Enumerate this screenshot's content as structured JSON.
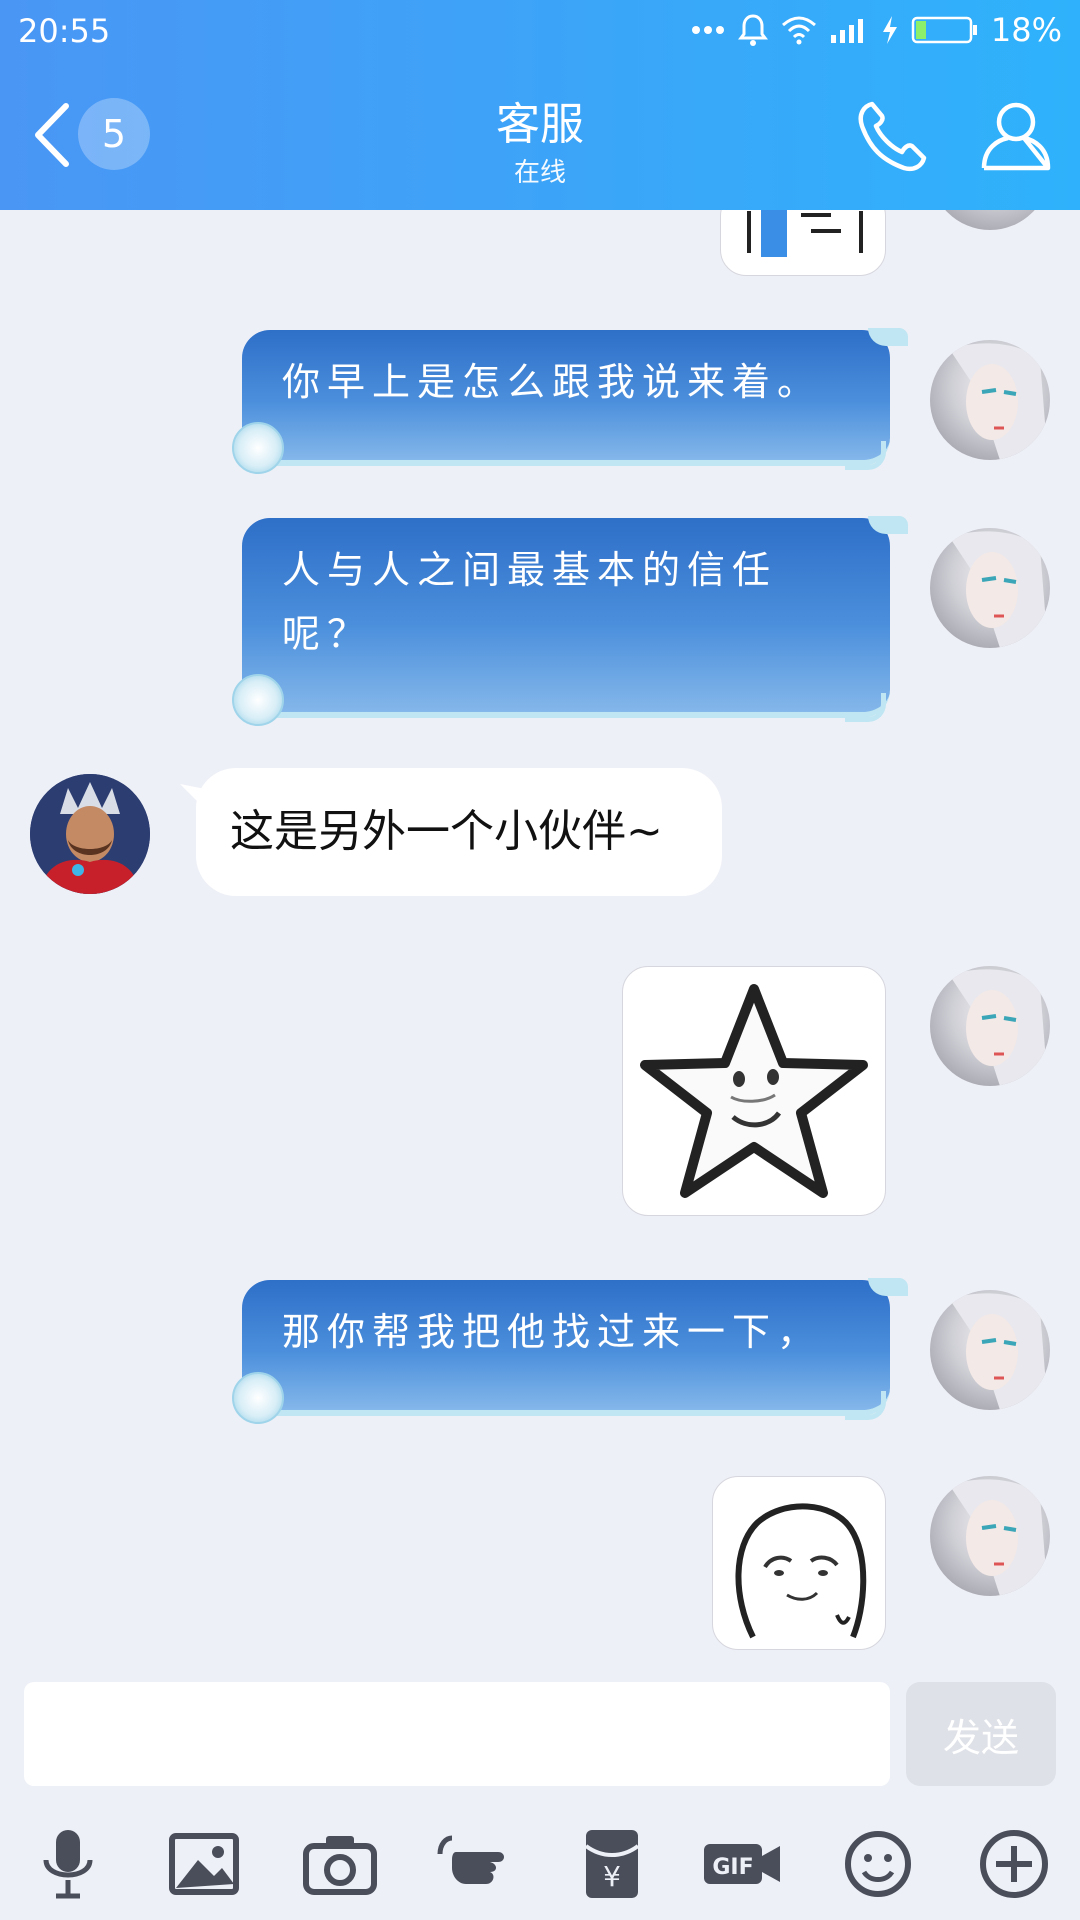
{
  "status_bar": {
    "time": "20:55",
    "battery": "18%"
  },
  "header": {
    "unread_count": "5",
    "title": "客服",
    "subtitle": "在线"
  },
  "messages": [
    {
      "side": "me",
      "type": "image",
      "content": "partial-image"
    },
    {
      "side": "me",
      "type": "text",
      "text": "你早上是怎么跟我说来着。"
    },
    {
      "side": "me",
      "type": "text",
      "text": "人与人之间最基本的信任呢？"
    },
    {
      "side": "other",
      "type": "text",
      "text": "这是另外一个小伙伴~"
    },
    {
      "side": "me",
      "type": "sticker",
      "content": "star-face-sticker"
    },
    {
      "side": "me",
      "type": "text",
      "text": "那你帮我把他找过来一下，"
    },
    {
      "side": "me",
      "type": "sticker",
      "content": "meme-face-sticker"
    }
  ],
  "composer": {
    "input_value": "",
    "send_label": "发送"
  },
  "toolbar": [
    "microphone-icon",
    "image-icon",
    "camera-icon",
    "poke-icon",
    "red-packet-icon",
    "gif-icon",
    "emoji-icon",
    "plus-icon"
  ],
  "colors": {
    "header_start": "#4a96f5",
    "header_end": "#2fb2fb",
    "background": "#eef0f7",
    "icons": "#4a4e5a"
  }
}
